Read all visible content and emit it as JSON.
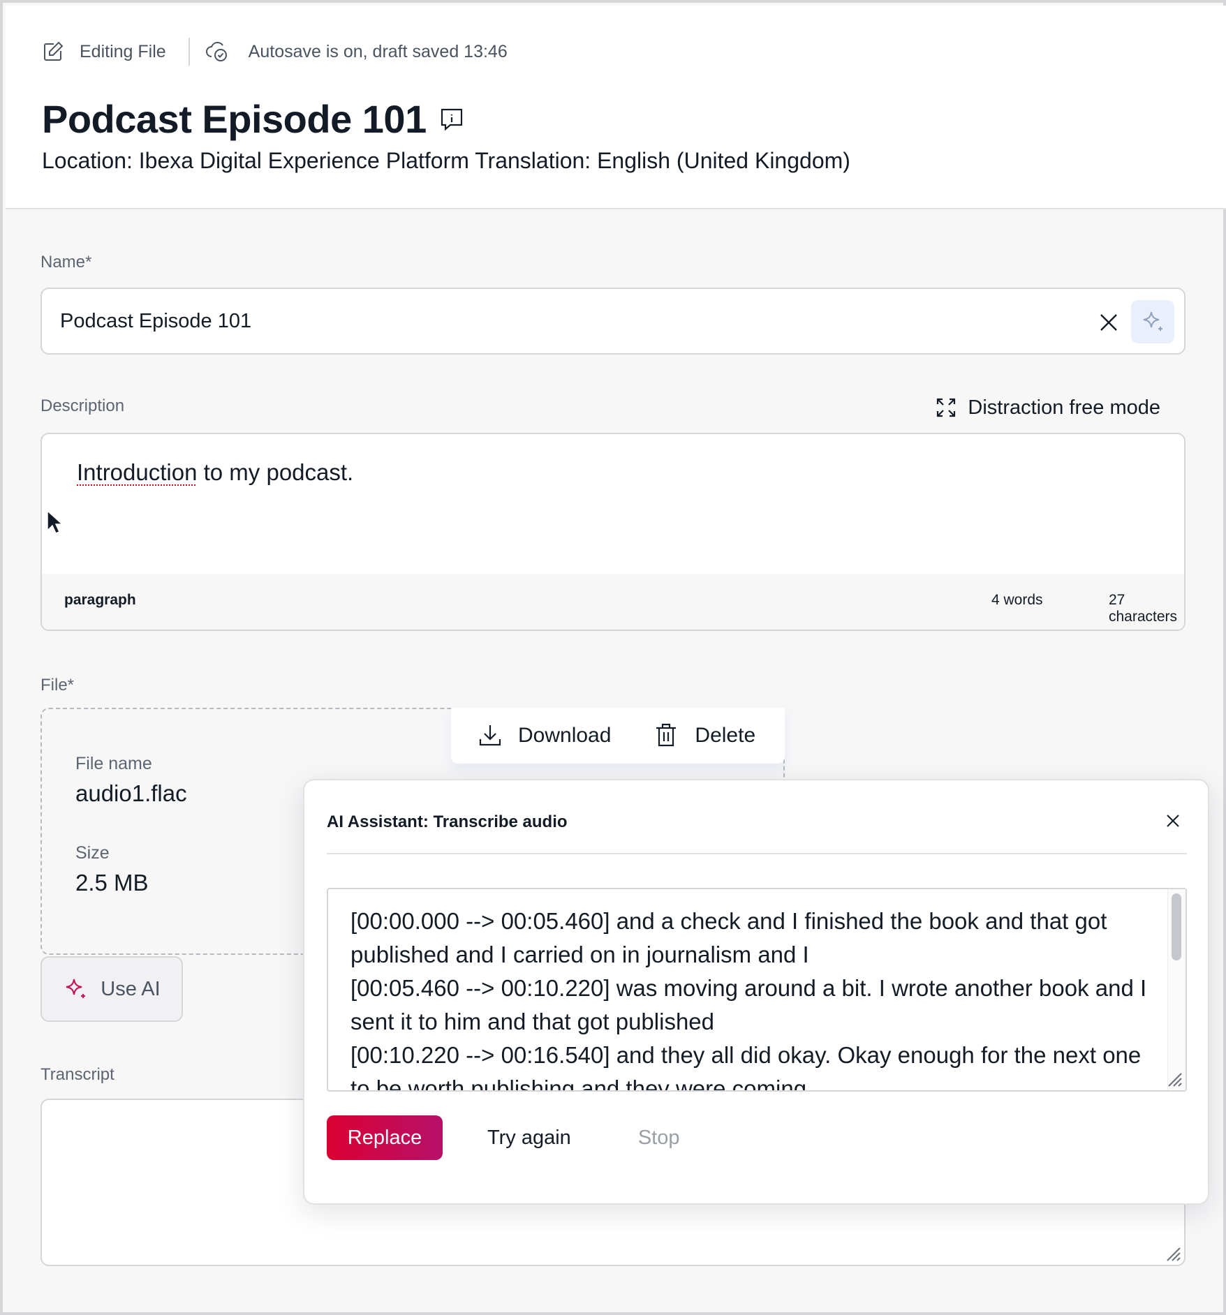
{
  "topbar": {
    "mode_label": "Editing File",
    "autosave_label": "Autosave is on, draft saved 13:46"
  },
  "header": {
    "title": "Podcast Episode 101",
    "subtitle": "Location: Ibexa Digital Experience Platform Translation: English (United Kingdom)"
  },
  "name_field": {
    "label": "Name*",
    "value": "Podcast Episode 101"
  },
  "description_field": {
    "label": "Description",
    "distraction_free_label": "Distraction free mode",
    "text_misspelled": "Introduction",
    "text_rest": " to my podcast.",
    "element_tag": "paragraph",
    "word_count": "4 words",
    "char_count": "27 characters"
  },
  "file_field": {
    "label": "File*",
    "file_name_label": "File name",
    "file_name": "audio1.flac",
    "size_label": "Size",
    "size": "2.5 MB",
    "download_label": "Download",
    "delete_label": "Delete",
    "use_ai_label": "Use AI"
  },
  "transcript_field": {
    "label": "Transcript"
  },
  "ai_panel": {
    "title": "AI Assistant: Transcribe audio",
    "result_lines": [
      "[00:00.000 --> 00:05.460]  and a check and I finished the book and that got published and I carried on in journalism and I",
      "[00:05.460 --> 00:10.220]  was moving around a bit. I wrote another book and I sent it to him and that got published",
      "[00:10.220 --> 00:16.540]  and they all did okay. Okay enough for the next one to be worth publishing and they were coming"
    ],
    "replace_label": "Replace",
    "try_again_label": "Try again",
    "stop_label": "Stop"
  },
  "colors": {
    "accent_start": "#db0032",
    "accent_end": "#b6116a",
    "text": "#131c26",
    "muted": "#5c6571",
    "border": "#d6d6d8",
    "ai_icon": "#c2185b"
  },
  "icons": {
    "edit": "edit-icon",
    "autosave": "cloud-check-icon",
    "info": "info-bubble-icon",
    "clear": "close-icon",
    "ai": "sparkle-icon",
    "expand": "expand-icon",
    "download": "download-icon",
    "delete": "trash-icon"
  }
}
